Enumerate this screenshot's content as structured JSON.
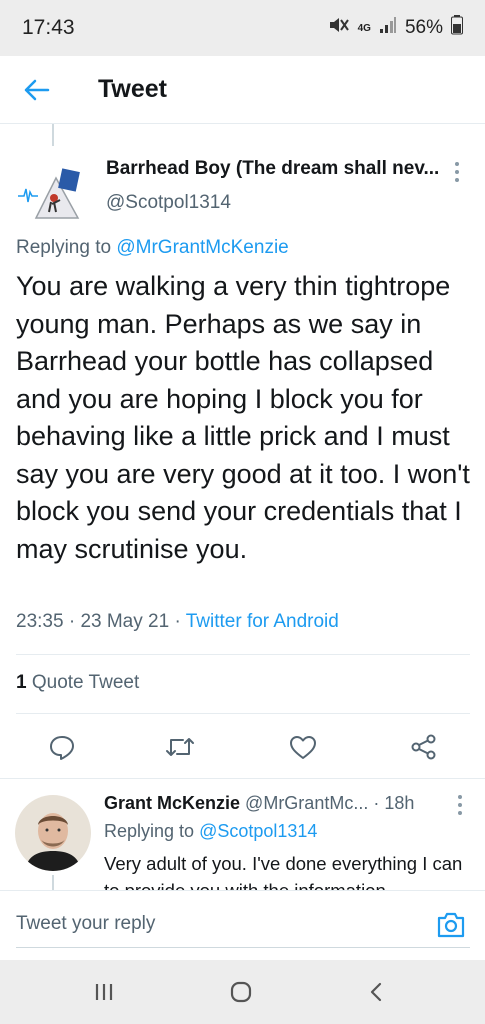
{
  "status_bar": {
    "time": "17:43",
    "network": "4G",
    "battery": "56%"
  },
  "header": {
    "title": "Tweet"
  },
  "tweet": {
    "author_name": "Barrhead Boy (The dream shall nev...",
    "author_handle": "@Scotpol1314",
    "replying_label": "Replying to",
    "replying_to": "@MrGrantMcKenzie",
    "text": "You are walking a very thin tightrope young man. Perhaps as we say in Barrhead your bottle has collapsed and you are hoping I block you for behaving like a little prick and I must say you are very good at it too. I won't block you send your credentials that I may scrutinise you.",
    "time": "23:35",
    "date": "23 May 21",
    "source": "Twitter for Android",
    "quote_count": "1",
    "quote_label": "Quote Tweet"
  },
  "reply": {
    "author_name": "Grant McKenzie",
    "author_handle": "@MrGrantMc...",
    "age": "18h",
    "replying_label": "Replying to",
    "replying_to": "@Scotpol1314",
    "text": "Very adult of you. I've done everything I can to provide you with the information"
  },
  "compose": {
    "placeholder": "Tweet your reply"
  },
  "colors": {
    "accent": "#1d9bf0",
    "muted": "#536471",
    "text": "#14171a",
    "divider": "#e6ecf0"
  }
}
